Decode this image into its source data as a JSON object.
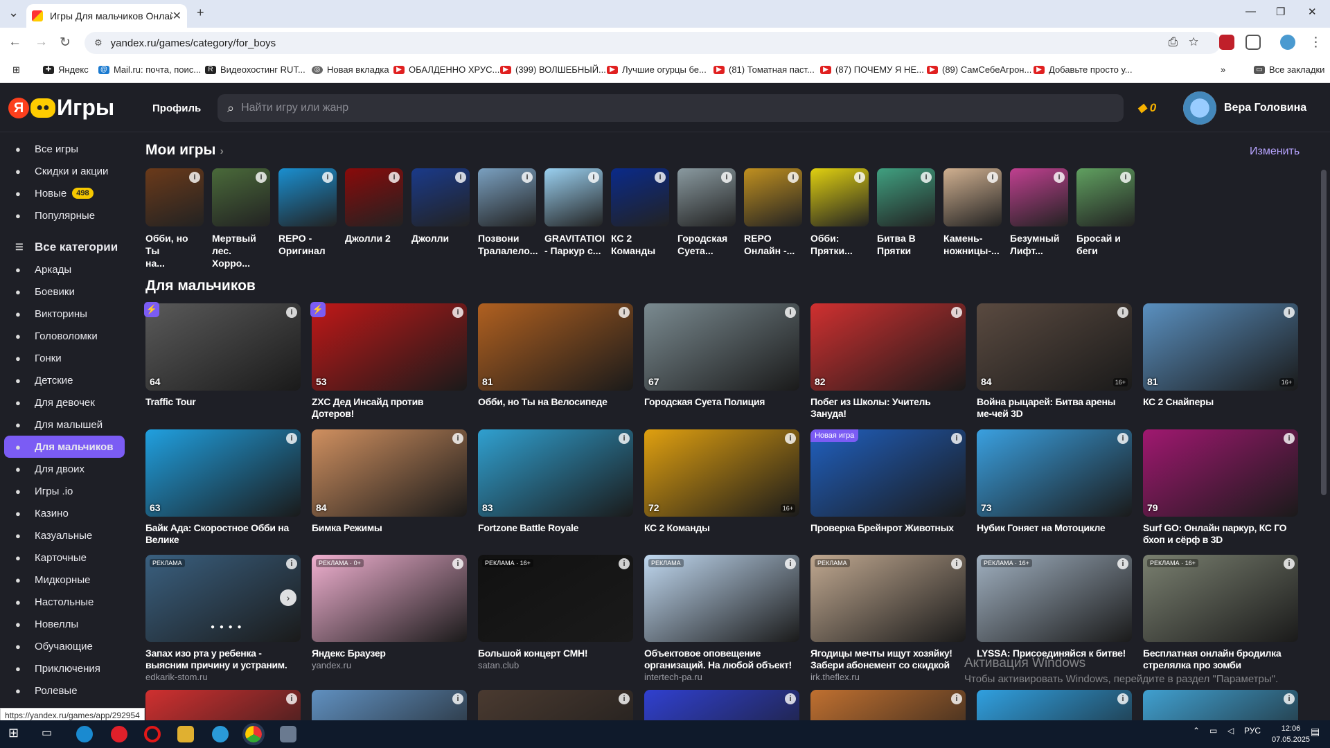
{
  "browser": {
    "tab_title": "Игры Для мальчиков Онлайн",
    "url": "yandex.ru/games/category/for_boys",
    "status_url": "https://yandex.ru/games/app/292954",
    "bookmarks": [
      "Яндекс",
      "Mail.ru: почта, поис...",
      "Видеохостинг RUT...",
      "Новая вкладка",
      "ОБАЛДЕННО ХРУС...",
      "(399) ВОЛШЕБНЫЙ...",
      "Лучшие огурцы бе...",
      "(81) Томатная паст...",
      "(87) ПОЧЕМУ Я НЕ...",
      "(89) СамСебеАгрон...",
      "Добавьте просто у..."
    ],
    "all_bookmarks": "Все закладки"
  },
  "header": {
    "logo": "Игры",
    "profile": "Профиль",
    "search_placeholder": "Найти игру или жанр",
    "coins": "0",
    "user": "Вера Головина"
  },
  "sidebar": [
    {
      "label": "Все игры",
      "icon": "gamepad-icon"
    },
    {
      "label": "Скидки и акции",
      "icon": "discount-icon"
    },
    {
      "label": "Новые",
      "icon": "rocket-icon",
      "badge": "498"
    },
    {
      "label": "Популярные",
      "icon": "heart-icon"
    },
    {
      "label": "Все категории",
      "icon": "list-icon",
      "big": true
    },
    {
      "label": "Аркады",
      "icon": "arcade-icon"
    },
    {
      "label": "Боевики",
      "icon": "bomb-icon"
    },
    {
      "label": "Викторины",
      "icon": "quiz-icon"
    },
    {
      "label": "Головоломки",
      "icon": "puzzle-icon"
    },
    {
      "label": "Гонки",
      "icon": "race-icon"
    },
    {
      "label": "Детские",
      "icon": "kids-icon"
    },
    {
      "label": "Для девочек",
      "icon": "girl-icon"
    },
    {
      "label": "Для малышей",
      "icon": "baby-icon"
    },
    {
      "label": "Для мальчиков",
      "icon": "boy-icon",
      "active": true
    },
    {
      "label": "Для двоих",
      "icon": "two-players-icon"
    },
    {
      "label": "Игры .io",
      "icon": "io-icon"
    },
    {
      "label": "Казино",
      "icon": "casino-icon"
    },
    {
      "label": "Казуальные",
      "icon": "casual-icon"
    },
    {
      "label": "Карточные",
      "icon": "cards-icon"
    },
    {
      "label": "Мидкорные",
      "icon": "midcore-icon"
    },
    {
      "label": "Настольные",
      "icon": "board-icon"
    },
    {
      "label": "Новеллы",
      "icon": "book-icon"
    },
    {
      "label": "Обучающие",
      "icon": "study-icon"
    },
    {
      "label": "Приключения",
      "icon": "adventure-icon"
    },
    {
      "label": "Ролевые",
      "icon": "rpg-icon"
    }
  ],
  "my_games": {
    "title": "Мои игры",
    "edit": "Изменить",
    "items": [
      {
        "t1": "Обби, но Ты",
        "t2": "на...",
        "c": "#6b3a1a"
      },
      {
        "t1": "Мертвый",
        "t2": "лес. Хорро...",
        "c": "#4a6a3a"
      },
      {
        "t1": "REPO -",
        "t2": "Оригинал",
        "c": "#1a8fd0"
      },
      {
        "t1": "Джолли 2",
        "t2": "",
        "c": "#8a0a0a"
      },
      {
        "t1": "Джолли",
        "t2": "",
        "c": "#1a3a8a"
      },
      {
        "t1": "Позвони",
        "t2": "Тралалело...",
        "c": "#7aa0c0"
      },
      {
        "t1": "GRAVITATIOI",
        "t2": "- Паркур с...",
        "c": "#9ad0f0"
      },
      {
        "t1": "КС 2",
        "t2": "Команды",
        "c": "#0a2a8a"
      },
      {
        "t1": "Городская",
        "t2": "Суета...",
        "c": "#8a9aa0"
      },
      {
        "t1": "REPO",
        "t2": "Онлайн -...",
        "c": "#c09020"
      },
      {
        "t1": "Обби:",
        "t2": "Прятки...",
        "c": "#e0d010"
      },
      {
        "t1": "Битва В",
        "t2": "Прятки",
        "c": "#40a080"
      },
      {
        "t1": "Камень-",
        "t2": "ножницы-...",
        "c": "#d0b090"
      },
      {
        "t1": "Безумный",
        "t2": "Лифт...",
        "c": "#c04090"
      },
      {
        "t1": "Бросай и",
        "t2": "беги",
        "c": "#60a060"
      }
    ]
  },
  "boys": {
    "title": "Для мальчиков",
    "rows": [
      [
        {
          "title": "Traffic Tour",
          "rating": "64",
          "bolt": true,
          "c": "#5a5a5a"
        },
        {
          "title": "ZXC Дед Инсайд против Дотеров!",
          "rating": "53",
          "bolt": true,
          "c": "#c01818"
        },
        {
          "title": "Обби, но Ты на Велосипеде",
          "rating": "81",
          "c": "#b06020"
        },
        {
          "title": "Городская Суета Полиция",
          "rating": "67",
          "c": "#7a8a90"
        },
        {
          "title": "Побег из Школы: Учитель Зануда!",
          "rating": "82",
          "c": "#d03030"
        },
        {
          "title": "Война рыцарей: Битва арены ме-чей 3D",
          "rating": "84",
          "c": "#5a4a40",
          "lim": "16+"
        },
        {
          "title": "КС 2 Снайперы",
          "rating": "81",
          "c": "#5a90c0",
          "lim": "16+"
        }
      ],
      [
        {
          "title": "Байк Ада: Скоростное Обби на Велике",
          "rating": "63",
          "c": "#20a0e0"
        },
        {
          "title": "Бимка Режимы",
          "rating": "84",
          "c": "#d09060"
        },
        {
          "title": "Fortzone Battle Royale",
          "rating": "83",
          "c": "#30a0d0"
        },
        {
          "title": "КС 2 Команды",
          "rating": "72",
          "c": "#e0a010",
          "lim": "16+"
        },
        {
          "title": "Проверка Брейнрот Животных",
          "rating": "",
          "c": "#2060c0",
          "new": "Новая игра"
        },
        {
          "title": "Нубик Гоняет на Мотоцикле",
          "rating": "73",
          "c": "#3aa0e0"
        },
        {
          "title": "Surf GO: Онлайн паркур, КС ГО бхоп и сёрф в 3D",
          "rating": "79",
          "c": "#a01870"
        }
      ],
      [
        {
          "title": "Запах изо рта у ребенка - выясним причину и устраним.",
          "sub": "edkarik-stom.ru",
          "ad": "РЕКЛАМА",
          "c": "#3a6080",
          "arrow": true
        },
        {
          "title": "Яндекс Браузер",
          "sub": "yandex.ru",
          "ad": "РЕКЛАМА · 0+",
          "c": "#f0b0d0"
        },
        {
          "title": "Большой концерт СМН!",
          "sub": "satan.club",
          "ad": "РЕКЛАМА · 16+",
          "c": "#111111"
        },
        {
          "title": "Объектовое оповещение организаций. На любой объект!",
          "sub": "intertech-pa.ru",
          "ad": "РЕКЛАМА",
          "c": "#c0d8f0"
        },
        {
          "title": "Ягодицы мечты ищут хозяйку! Забери абонемент со скидкой",
          "sub": "irk.theflex.ru",
          "ad": "РЕКЛАМА",
          "c": "#c0a890"
        },
        {
          "title": "LYSSA: Присоединяйся к битве!",
          "sub": "",
          "ad": "РЕКЛАМА · 16+",
          "c": "#a0b0c0"
        },
        {
          "title": "Бесплатная онлайн бродилка стрелялка про зомби",
          "sub": "",
          "ad": "РЕКЛАМА · 16+",
          "c": "#7a8070"
        }
      ],
      [
        {
          "c": "#d03030"
        },
        {
          "c": "#6090c0"
        },
        {
          "c": "#4a3a30"
        },
        {
          "c": "#3040d0"
        },
        {
          "c": "#c07030"
        },
        {
          "c": "#30a0e0"
        },
        {
          "c": "#40a0d0"
        }
      ]
    ]
  },
  "watermark": {
    "line1": "Активация Windows",
    "line2": "Чтобы активировать Windows, перейдите в раздел \"Параметры\"."
  },
  "taskbar": {
    "lang": "РУС",
    "time": "12:06",
    "date": "07.05.2025"
  }
}
